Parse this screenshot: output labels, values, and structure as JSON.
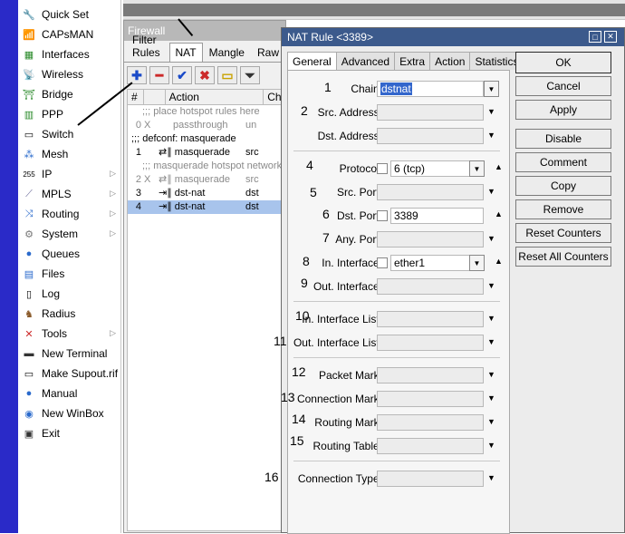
{
  "sidebar": {
    "items": [
      {
        "label": "Quick Set",
        "icon": "quick-set-icon",
        "has_submenu": false
      },
      {
        "label": "CAPsMAN",
        "icon": "capsman-icon",
        "has_submenu": false
      },
      {
        "label": "Interfaces",
        "icon": "interfaces-icon",
        "has_submenu": false
      },
      {
        "label": "Wireless",
        "icon": "wireless-icon",
        "has_submenu": false
      },
      {
        "label": "Bridge",
        "icon": "bridge-icon",
        "has_submenu": false
      },
      {
        "label": "PPP",
        "icon": "ppp-icon",
        "has_submenu": false
      },
      {
        "label": "Switch",
        "icon": "switch-icon",
        "has_submenu": false
      },
      {
        "label": "Mesh",
        "icon": "mesh-icon",
        "has_submenu": false
      },
      {
        "label": "IP",
        "icon": "ip-icon",
        "has_submenu": true
      },
      {
        "label": "MPLS",
        "icon": "mpls-icon",
        "has_submenu": true
      },
      {
        "label": "Routing",
        "icon": "routing-icon",
        "has_submenu": true
      },
      {
        "label": "System",
        "icon": "system-icon",
        "has_submenu": true
      },
      {
        "label": "Queues",
        "icon": "queues-icon",
        "has_submenu": false
      },
      {
        "label": "Files",
        "icon": "files-icon",
        "has_submenu": false
      },
      {
        "label": "Log",
        "icon": "log-icon",
        "has_submenu": false
      },
      {
        "label": "Radius",
        "icon": "radius-icon",
        "has_submenu": false
      },
      {
        "label": "Tools",
        "icon": "tools-icon",
        "has_submenu": true
      },
      {
        "label": "New Terminal",
        "icon": "terminal-icon",
        "has_submenu": false
      },
      {
        "label": "Make Supout.rif",
        "icon": "supout-icon",
        "has_submenu": false
      },
      {
        "label": "Manual",
        "icon": "manual-icon",
        "has_submenu": false
      },
      {
        "label": "New WinBox",
        "icon": "winbox-icon",
        "has_submenu": false
      },
      {
        "label": "Exit",
        "icon": "exit-icon",
        "has_submenu": false
      }
    ]
  },
  "firewall": {
    "title": "Firewall",
    "tabs": [
      "Filter Rules",
      "NAT",
      "Mangle",
      "Raw"
    ],
    "active_tab": "NAT",
    "columns": [
      "#",
      "Action",
      "Ch"
    ],
    "rows": [
      {
        "type": "comment",
        "text": ";;; place hotspot rules here"
      },
      {
        "num": "0",
        "flag": "X",
        "action": "passthrough",
        "chain": "un",
        "grey": true
      },
      {
        "type": "comment-dark",
        "text": ";;; defconf: masquerade"
      },
      {
        "num": "1",
        "flag": "",
        "action": "masquerade",
        "chain": "src",
        "grey": false
      },
      {
        "type": "comment",
        "text": ";;; masquerade hotspot network"
      },
      {
        "num": "2",
        "flag": "X",
        "action": "masquerade",
        "chain": "src",
        "grey": true
      },
      {
        "num": "3",
        "flag": "",
        "action": "dst-nat",
        "chain": "dst",
        "grey": false
      },
      {
        "num": "4",
        "flag": "",
        "action": "dst-nat",
        "chain": "dst",
        "grey": false,
        "selected": true
      }
    ]
  },
  "dialog": {
    "title": "NAT Rule <3389>",
    "tabs": [
      "General",
      "Advanced",
      "Extra",
      "Action",
      "Statistics"
    ],
    "active_tab": "General",
    "fields": [
      {
        "label": "Chain:",
        "value": "dstnat",
        "num": "1"
      },
      {
        "label": "Src. Address:",
        "value": "",
        "num": "2"
      },
      {
        "label": "Dst. Address:",
        "value": "",
        "num": ""
      },
      {
        "label": "Protocol:",
        "value": "6 (tcp)",
        "num": "4"
      },
      {
        "label": "Src. Port:",
        "value": "",
        "num": "5"
      },
      {
        "label": "Dst. Port:",
        "value": "3389",
        "num": "6"
      },
      {
        "label": "Any. Port:",
        "value": "",
        "num": "7"
      },
      {
        "label": "In. Interface:",
        "value": "ether1",
        "num": "8"
      },
      {
        "label": "Out. Interface:",
        "value": "",
        "num": "9"
      },
      {
        "label": "In. Interface List:",
        "value": "",
        "num": "10"
      },
      {
        "label": "Out. Interface List:",
        "value": "",
        "num": "11"
      },
      {
        "label": "Packet Mark:",
        "value": "",
        "num": "12"
      },
      {
        "label": "Connection Mark:",
        "value": "",
        "num": "13"
      },
      {
        "label": "Routing Mark:",
        "value": "",
        "num": "14"
      },
      {
        "label": "Routing Table:",
        "value": "",
        "num": "15"
      },
      {
        "label": "Connection Type:",
        "value": "",
        "num": "16"
      }
    ],
    "buttons": [
      "OK",
      "Cancel",
      "Apply",
      "Disable",
      "Comment",
      "Copy",
      "Remove",
      "Reset Counters",
      "Reset All Counters"
    ]
  },
  "colors": {
    "accent": "#3c5a8c",
    "sidebar_strip": "#2a2ac8",
    "selection": "#a8c4ec"
  }
}
